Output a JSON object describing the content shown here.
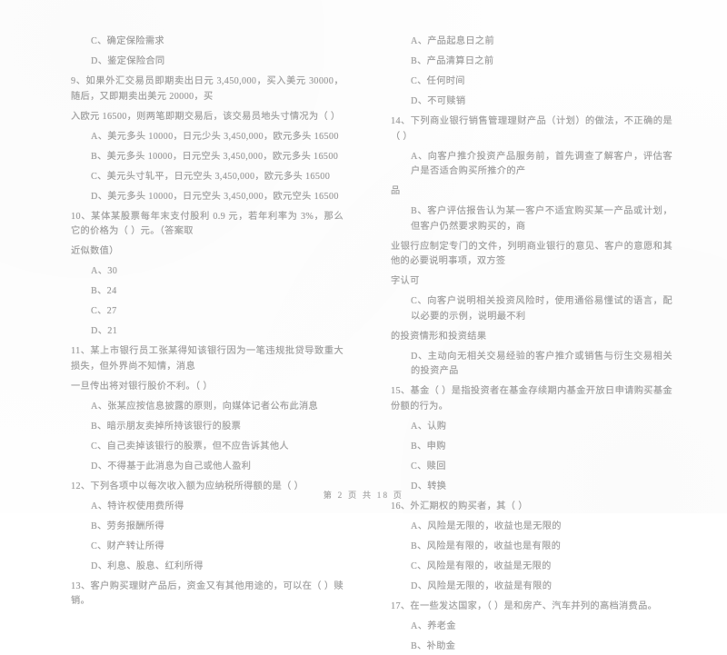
{
  "document": {
    "type": "scanned-exam-paper",
    "language": "zh-CN",
    "footer": "第 2 页 共 18 页",
    "text_color": "#a3a3a3",
    "background_color": "#fefefe"
  },
  "left_column": {
    "blocks": [
      {
        "kind": "option",
        "text": "C、确定保险需求"
      },
      {
        "kind": "option",
        "text": "D、鉴定保险合同"
      },
      {
        "kind": "question",
        "text": "9、如果外汇交易员即期卖出日元 3,450,000，买入美元 30000，随后，又即期卖出美元 20000，买"
      },
      {
        "kind": "continuation",
        "text": "入欧元 16500，则两笔即期交易后，该交易员地头寸情况为（      ）"
      },
      {
        "kind": "option",
        "text": "A、美元多头 10000，日元少头 3,450,000，欧元多头 16500"
      },
      {
        "kind": "option",
        "text": "B、美元多头 10000，日元空头 3,450,000，欧元多头 16500"
      },
      {
        "kind": "option",
        "text": "C、美元头寸轧平，日元空头 3,450,000，欧元多头 16500"
      },
      {
        "kind": "option",
        "text": "D、美元多头 10000，日元空头 3,450,000，欧元空头 16500"
      },
      {
        "kind": "question",
        "text": "10、某体某股票每年末支付股利 0.9 元，若年利率为 3%，那么它的价格为（      ）元。（答案取"
      },
      {
        "kind": "continuation",
        "text": "近似数值）"
      },
      {
        "kind": "option",
        "text": "A、30"
      },
      {
        "kind": "option",
        "text": "B、24"
      },
      {
        "kind": "option",
        "text": "C、27"
      },
      {
        "kind": "option",
        "text": "D、21"
      },
      {
        "kind": "question",
        "text": "11、某上市银行员工张某得知该银行因为一笔违规批贷导致重大损失，但外界尚不知情，消息"
      },
      {
        "kind": "continuation",
        "text": "一旦传出将对银行股价不利。（      ）"
      },
      {
        "kind": "option",
        "text": "A、张某应按信息披露的原则，向媒体记者公布此消息"
      },
      {
        "kind": "option",
        "text": "B、暗示朋友卖掉所持该银行的股票"
      },
      {
        "kind": "option",
        "text": "C、自己卖掉该银行的股票，但不应告诉其他人"
      },
      {
        "kind": "option",
        "text": "D、不得基于此消息为自己或他人盈利"
      },
      {
        "kind": "question",
        "text": "12、下列各项中以每次收入额为应纳税所得额的是（      ）"
      },
      {
        "kind": "option",
        "text": "A、特许权使用费所得"
      },
      {
        "kind": "option",
        "text": "B、劳务报酬所得"
      },
      {
        "kind": "option",
        "text": "C、财产转让所得"
      },
      {
        "kind": "option",
        "text": "D、利息、股息、红利所得"
      },
      {
        "kind": "question",
        "text": "13、客户购买理财产品后，资金又有其他用途的，可以在（      ）赎销。"
      }
    ]
  },
  "right_column": {
    "blocks": [
      {
        "kind": "option",
        "text": "A、产品起息日之前"
      },
      {
        "kind": "option",
        "text": "B、产品清算日之前"
      },
      {
        "kind": "option",
        "text": "C、任何时间"
      },
      {
        "kind": "option",
        "text": "D、不可赎销"
      },
      {
        "kind": "question",
        "text": "14、下列商业银行销售管理理财产品（计划）的做法，不正确的是（      ）"
      },
      {
        "kind": "option",
        "text": "A、向客户推介投资产品服务前，首先调查了解客户，评估客户是否适合购买所推介的产"
      },
      {
        "kind": "continuation",
        "text": "品"
      },
      {
        "kind": "option",
        "text": "B、客户评估报告认为某一客户不适宜购买某一产品或计划，但客户仍然要求购买的，商"
      },
      {
        "kind": "continuation",
        "text": "业银行应制定专门的文件，列明商业银行的意见、客户的意愿和其他的必要说明事项，双方签"
      },
      {
        "kind": "continuation",
        "text": "字认可"
      },
      {
        "kind": "option",
        "text": "C、向客户说明相关投资风险时，使用通俗易懂试的语言，配以必要的示例，说明最不利"
      },
      {
        "kind": "continuation",
        "text": "的投资情形和投资结果"
      },
      {
        "kind": "option",
        "text": "D、主动向无相关交易经验的客户推介或销售与衍生交易相关的投资产品"
      },
      {
        "kind": "question",
        "text": "15、基金（      ）是指投资者在基金存续期内基金开放日申请购买基金份额的行为。"
      },
      {
        "kind": "option",
        "text": "A、认购"
      },
      {
        "kind": "option",
        "text": "B、申购"
      },
      {
        "kind": "option",
        "text": "C、赎回"
      },
      {
        "kind": "option",
        "text": "D、转换"
      },
      {
        "kind": "question",
        "text": "16、外汇期权的购买者，其（      ）"
      },
      {
        "kind": "option",
        "text": "A、风险是无限的，收益也是无限的"
      },
      {
        "kind": "option",
        "text": "B、风险是有限的，收益也是有限的"
      },
      {
        "kind": "option",
        "text": "C、风险是有限的，收益是无限的"
      },
      {
        "kind": "option",
        "text": "D、风险是无限的，收益是有限的"
      },
      {
        "kind": "question",
        "text": "17、在一些发达国家，（      ）是和房产、汽车并列的高档消费品。"
      },
      {
        "kind": "option",
        "text": "A、养老金"
      },
      {
        "kind": "option",
        "text": "B、补助金"
      }
    ]
  }
}
